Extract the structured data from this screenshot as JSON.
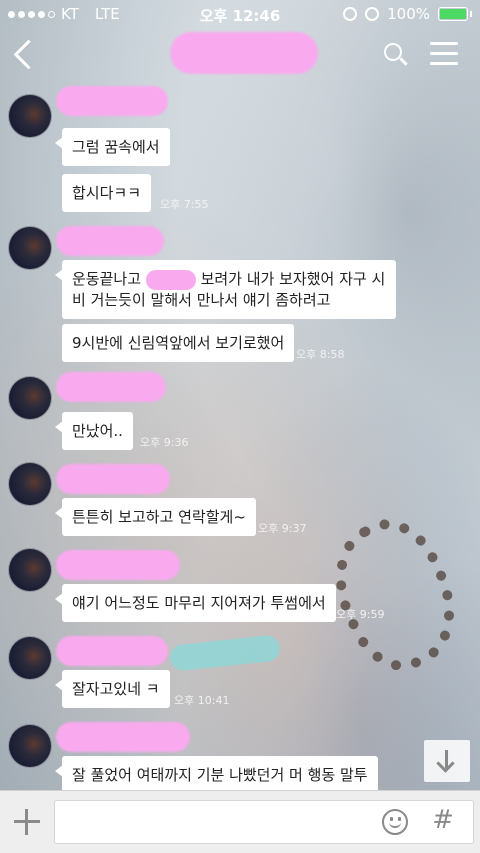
{
  "status_bar": {
    "carrier": "KT",
    "network": "LTE",
    "time": "오후 12:46",
    "battery": "100%",
    "battery_level": 1.0
  },
  "header": {
    "title_redacted": true,
    "back_icon": "chevron-left-icon",
    "search_icon": "search-icon",
    "menu_icon": "hamburger-menu-icon"
  },
  "messages": [
    {
      "bubbles": [
        "그럼 꿈속에서",
        "합시다ㅋㅋ"
      ],
      "time": "오후 7:55"
    },
    {
      "bubbles_a_pre": "운동끝나고",
      "bubbles_a_post": "보려가 내가 보자했어 자구 시비 거는듯이 말해서 만나서 얘기 좀하려고",
      "bubble_b": "9시반에 신림역앞에서 보기로했어",
      "time": "오후 8:58"
    },
    {
      "bubbles": [
        "만났어.."
      ],
      "time": "오후 9:36"
    },
    {
      "bubbles": [
        "튼튼히 보고하고 연락할게~"
      ],
      "time": "오후 9:37"
    },
    {
      "bubbles": [
        "얘기 어느정도 마무리 지어져가 투썸에서"
      ],
      "time": "오후 9:59"
    },
    {
      "bubbles": [
        "잘자고있네 ㅋ"
      ],
      "time": "오후 10:41"
    },
    {
      "bubbles": [
        "잘 풀었어 여태까지 기분 나빴던거 머 행동 말투"
      ]
    }
  ],
  "input_bar": {
    "placeholder": "",
    "plus_icon": "plus-icon",
    "emoji_icon": "emoji-smile-icon",
    "hash_label": "#"
  },
  "scroll_button": {
    "icon": "arrow-down-icon"
  }
}
